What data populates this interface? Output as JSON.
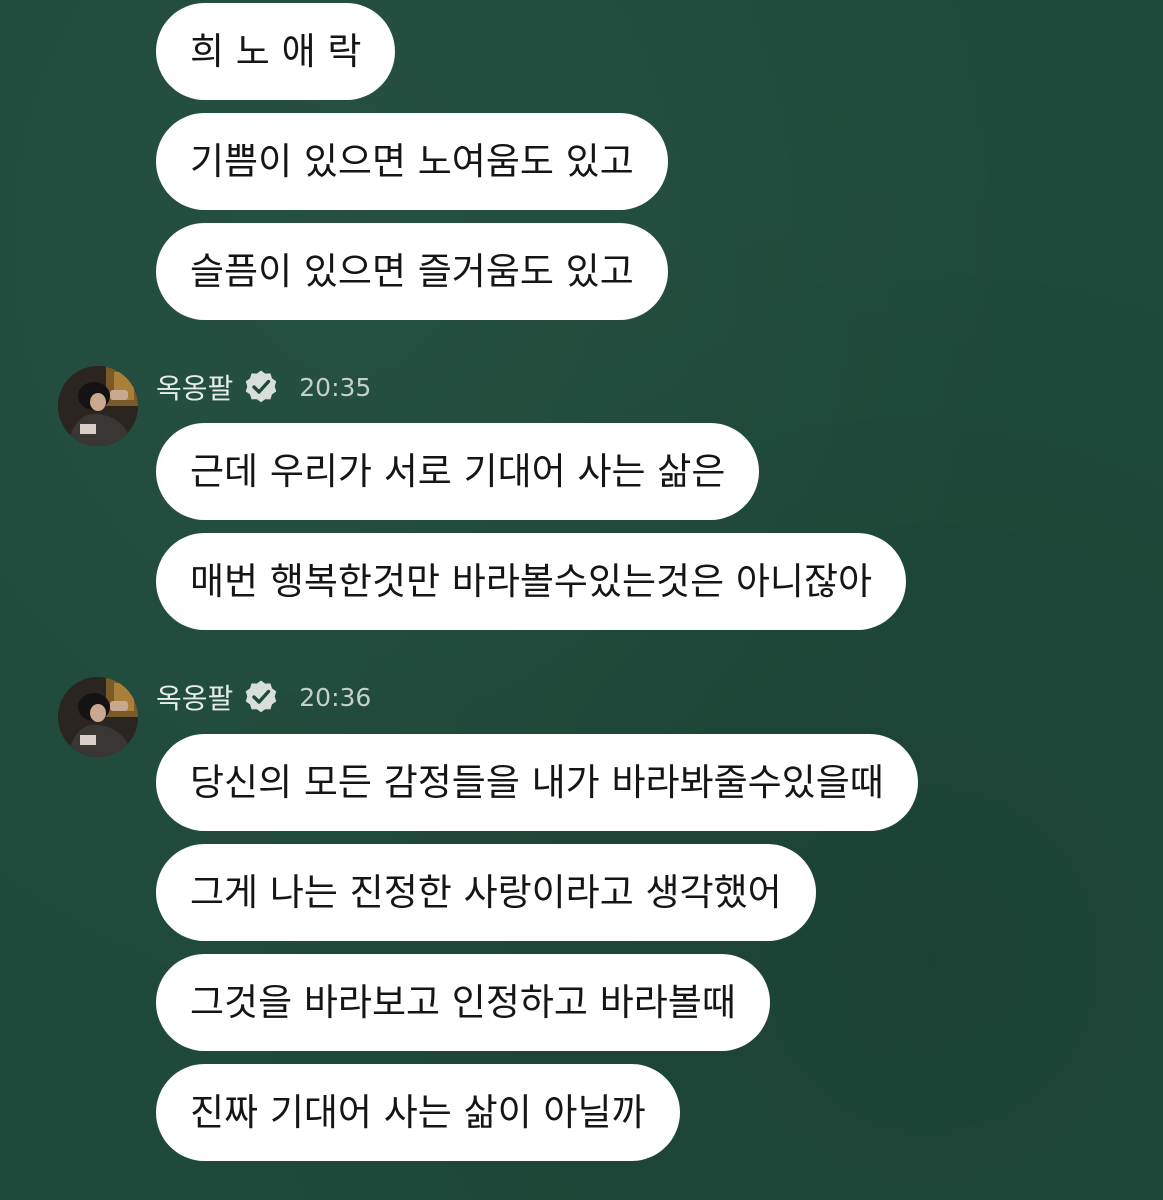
{
  "colors": {
    "background": "#1f4a3b",
    "bubble": "#ffffff",
    "bubble_text": "#151515",
    "sender_text": "#e4ece8",
    "time_text": "#c3d0ca"
  },
  "groups": [
    {
      "messages": [
        "희 노 애 락",
        "기쁨이 있으면 노여움도 있고",
        "슬픔이 있으면 즐거움도 있고"
      ]
    },
    {
      "sender": "옥옹팔",
      "verified_icon": "verified-check-icon",
      "time": "20:35",
      "messages": [
        "근데 우리가 서로 기대어 사는 삶은",
        "매번 행복한것만 바라볼수있는것은 아니잖아"
      ]
    },
    {
      "sender": "옥옹팔",
      "verified_icon": "verified-check-icon",
      "time": "20:36",
      "messages": [
        "당신의 모든 감정들을 내가 바라봐줄수있을때",
        "그게 나는 진정한 사랑이라고 생각했어",
        "그것을 바라보고 인정하고 바라볼때",
        "진짜 기대어 사는 삶이 아닐까"
      ]
    }
  ]
}
